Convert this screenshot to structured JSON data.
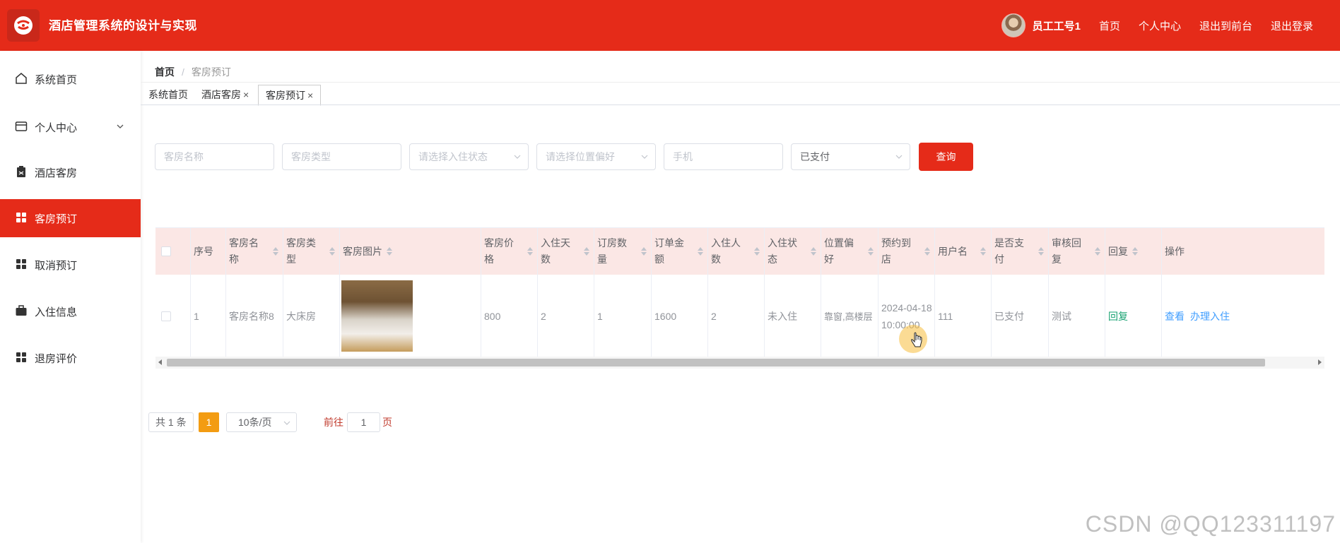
{
  "header": {
    "title": "酒店管理系统的设计与实现",
    "user_name": "员工工号1",
    "links": [
      "首页",
      "个人中心",
      "退出到前台",
      "退出登录"
    ]
  },
  "sidebar": {
    "items": [
      {
        "label": "系统首页",
        "icon": "home-icon"
      },
      {
        "label": "个人中心",
        "icon": "id-card-icon"
      },
      {
        "label": "酒店客房",
        "icon": "clipboard-icon"
      },
      {
        "label": "客房预订",
        "icon": "grid-icon"
      },
      {
        "label": "取消预订",
        "icon": "grid-icon"
      },
      {
        "label": "入住信息",
        "icon": "briefcase-icon"
      },
      {
        "label": "退房评价",
        "icon": "grid-icon"
      }
    ],
    "active_index": 3
  },
  "breadcrumb": {
    "home": "首页",
    "sep": "/",
    "current": "客房预订"
  },
  "tabs": [
    {
      "label": "系统首页"
    },
    {
      "label": "酒店客房",
      "close": "×"
    },
    {
      "label": "客房预订",
      "close": "×"
    }
  ],
  "filters": {
    "room_name_placeholder": "客房名称",
    "room_type_placeholder": "客房类型",
    "checkin_status_placeholder": "请选择入住状态",
    "location_pref_placeholder": "请选择位置偏好",
    "phone_placeholder": "手机",
    "payment_value": "已支付",
    "query_label": "查询"
  },
  "table": {
    "headers": [
      "序号",
      "客房名称",
      "客房类型",
      "客房图片",
      "客房价格",
      "入住天数",
      "订房数量",
      "订单金额",
      "入住人数",
      "入住状态",
      "位置偏好",
      "预约到店",
      "用户名",
      "是否支付",
      "审核回复",
      "回复",
      "操作"
    ],
    "rows": [
      {
        "index": "1",
        "room_name": "客房名称8",
        "room_type": "大床房",
        "price": "800",
        "days": "2",
        "rooms": "1",
        "amount": "1600",
        "guests": "2",
        "status": "未入住",
        "location": "靠窗,高楼层",
        "arrival_date": "2024-04-18",
        "arrival_time": "10:00:00",
        "username": "111",
        "paid": "已支付",
        "review_reply": "测试",
        "reply_action": "回复",
        "view_action": "查看",
        "checkin_action": "办理入住"
      }
    ]
  },
  "pagination": {
    "total": "共 1 条",
    "current_page": "1",
    "page_size": "10条/页",
    "goto_prefix": "前往",
    "goto_value": "1",
    "goto_suffix": "页"
  },
  "watermark": "CSDN @QQ123311197",
  "colors": {
    "brand": "#e52b19",
    "header_row": "#fbe7e5",
    "link": "#409eff",
    "reply": "#1aa373",
    "page_active": "#f39c12"
  }
}
